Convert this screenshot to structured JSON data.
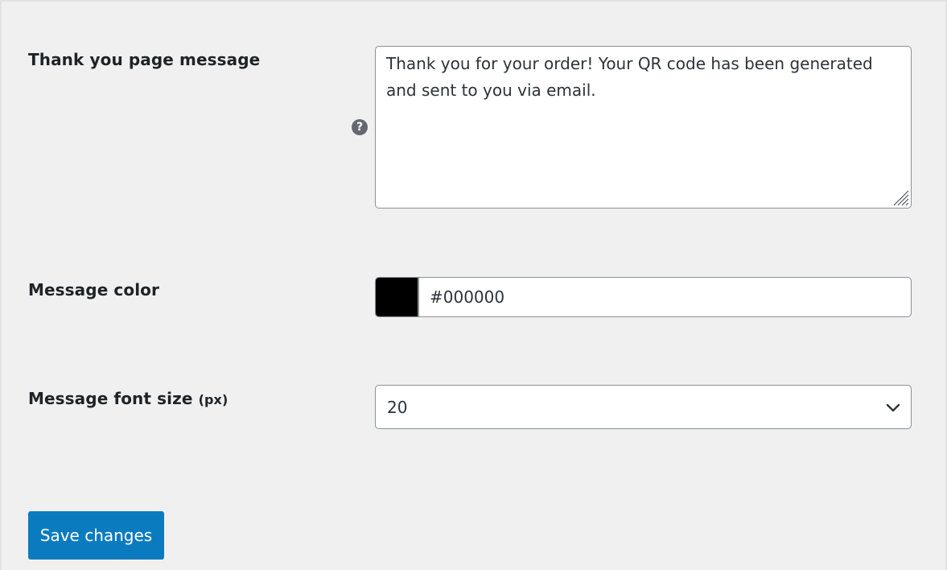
{
  "fields": {
    "thank_you_message": {
      "label": "Thank you page message",
      "value": "Thank you for your order! Your QR code has been generated and sent to you via email.",
      "help_icon": "question-mark-icon",
      "help_glyph": "?"
    },
    "message_color": {
      "label": "Message color",
      "swatch_color": "#000000",
      "value": "#000000"
    },
    "message_font_size": {
      "label": "Message font size",
      "unit": "(px)",
      "selected": "20",
      "icon": "chevron-down-icon"
    }
  },
  "actions": {
    "save_label": "Save changes"
  },
  "colors": {
    "background": "#f0f0f1",
    "primary_button": "#0b7bc0",
    "border": "#8c8f94"
  }
}
